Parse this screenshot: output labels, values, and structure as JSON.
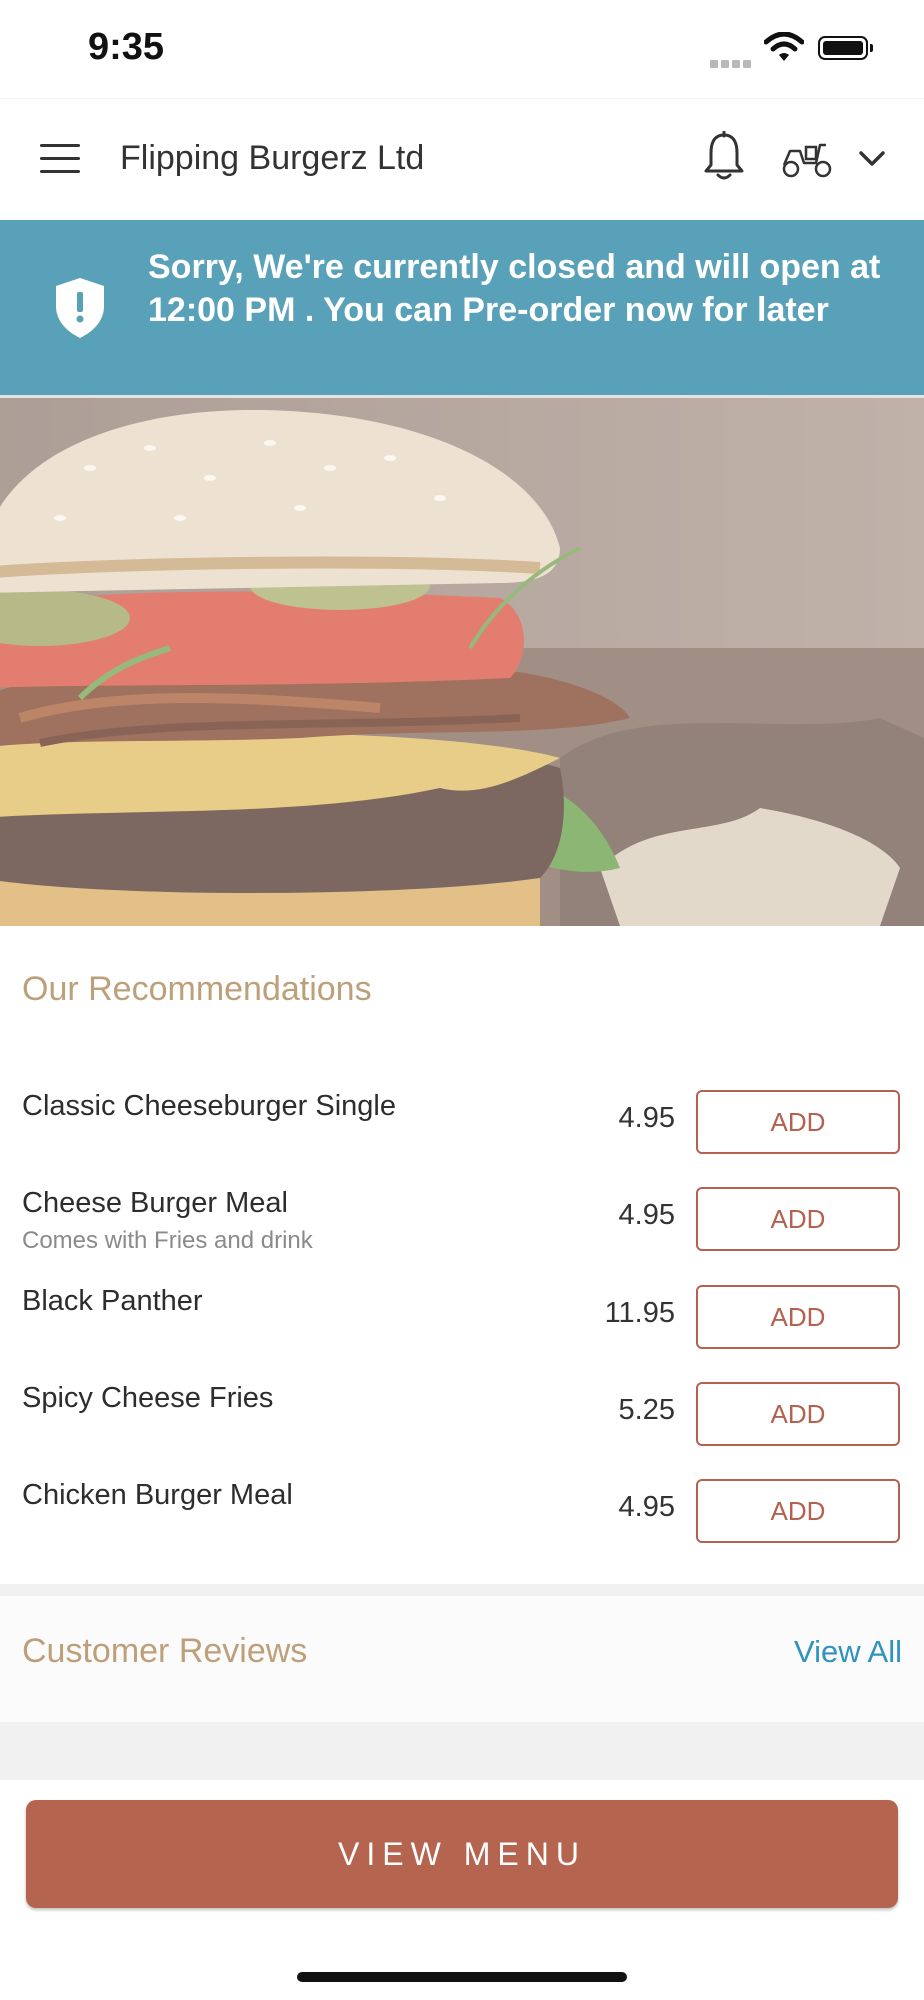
{
  "status_bar": {
    "time": "9:35"
  },
  "header": {
    "title": "Flipping Burgerz Ltd"
  },
  "banner": {
    "message": "Sorry, We're currently closed and will open at 12:00 PM . You can Pre-order now for later"
  },
  "recommendations": {
    "title": "Our Recommendations",
    "items": [
      {
        "name": "Classic Cheeseburger Single",
        "description": "",
        "price": "4.95",
        "button": "ADD"
      },
      {
        "name": "Cheese Burger Meal",
        "description": "Comes with Fries and drink",
        "price": "4.95",
        "button": "ADD"
      },
      {
        "name": "Black Panther",
        "description": "",
        "price": "11.95",
        "button": "ADD"
      },
      {
        "name": "Spicy Cheese Fries",
        "description": "",
        "price": "5.25",
        "button": "ADD"
      },
      {
        "name": "Chicken Burger Meal",
        "description": "",
        "price": "4.95",
        "button": "ADD"
      }
    ]
  },
  "reviews": {
    "title": "Customer Reviews",
    "link": "View All"
  },
  "footer": {
    "button": "VIEW MENU"
  },
  "colors": {
    "banner": "#58a1b8",
    "accent": "#b5654f",
    "section_title": "#bda07a",
    "link": "#2f92bf"
  },
  "icons": [
    "menu-icon",
    "bell-icon",
    "scooter-icon",
    "chevron-down-icon",
    "shield-alert-icon",
    "wifi-icon",
    "battery-icon"
  ]
}
